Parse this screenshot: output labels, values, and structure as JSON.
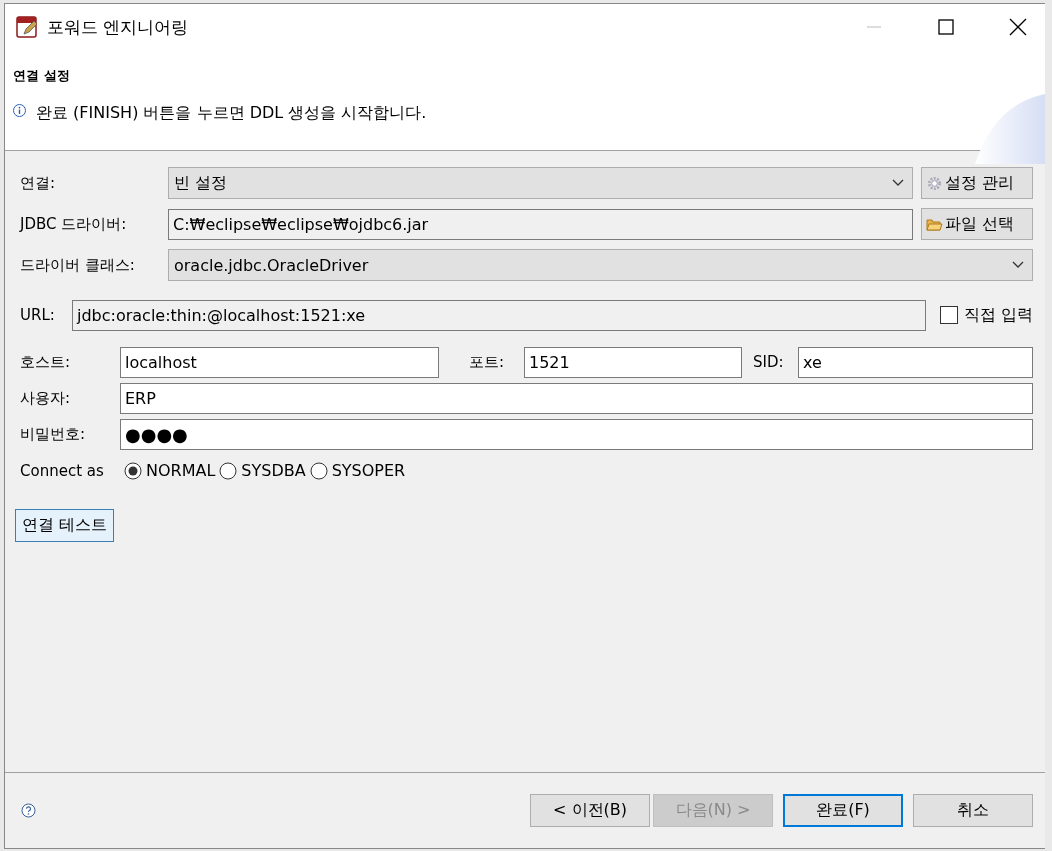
{
  "window": {
    "title": "포워드 엔지니어링"
  },
  "header": {
    "title": "연결 설정",
    "message": "완료 (FINISH) 버튼을 누르면 DDL 생성을 시작합니다."
  },
  "connection": {
    "label": "연결:",
    "value": "빈 설정",
    "button": "설정 관리"
  },
  "driver": {
    "label": "JDBC 드라이버:",
    "value": "C:₩eclipse₩eclipse₩ojdbc6.jar",
    "button": "파일 선택"
  },
  "driver_class": {
    "label": "드라이버 클래스:",
    "value": "oracle.jdbc.OracleDriver"
  },
  "url": {
    "label": "URL:",
    "value": "jdbc:oracle:thin:@localhost:1521:xe",
    "direct_input": {
      "label": "직접 입력",
      "checked": false
    }
  },
  "host": {
    "label": "호스트:",
    "value": "localhost"
  },
  "port": {
    "label": "포트:",
    "value": "1521"
  },
  "sid": {
    "label": "SID:",
    "value": "xe"
  },
  "user": {
    "label": "사용자:",
    "value": "ERP"
  },
  "password": {
    "label": "비밀번호:",
    "value": "●●●●"
  },
  "connect_as": {
    "label": "Connect as",
    "options": [
      {
        "label": "NORMAL",
        "selected": true
      },
      {
        "label": "SYSDBA",
        "selected": false
      },
      {
        "label": "SYSOPER",
        "selected": false
      }
    ]
  },
  "test_button": "연결 테스트",
  "buttons": [
    {
      "label": "< 이전(B)",
      "disabled": false,
      "default": false
    },
    {
      "label": "다음(N) >",
      "disabled": true,
      "default": false
    },
    {
      "label": "완료(F)",
      "disabled": false,
      "default": true
    },
    {
      "label": "취소",
      "disabled": false,
      "default": false
    }
  ]
}
